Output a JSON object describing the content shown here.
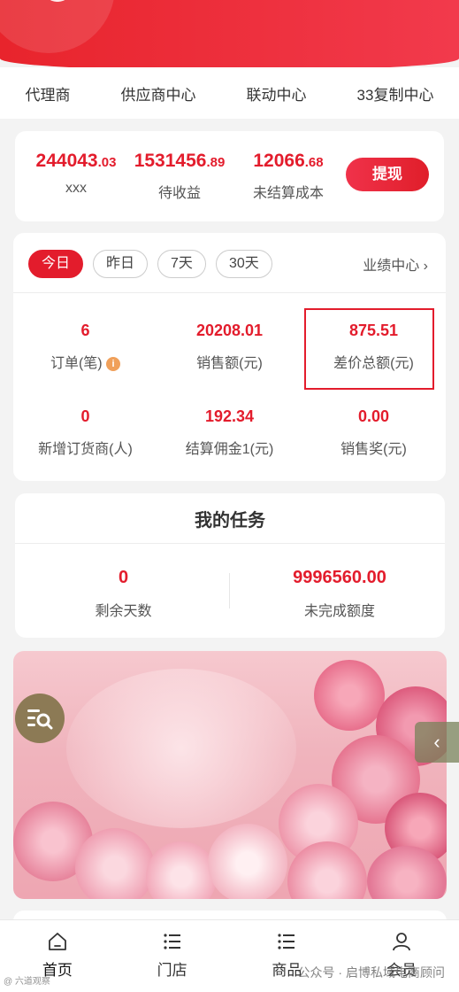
{
  "nav": {
    "items": [
      "代理商",
      "供应商中心",
      "联动中心",
      "33复制中心"
    ]
  },
  "earnings": {
    "items": [
      {
        "int": "244043",
        "dec": ".03",
        "label": "xxx"
      },
      {
        "int": "1531456",
        "dec": ".89",
        "label": "待收益"
      },
      {
        "int": "12066",
        "dec": ".68",
        "label": "未结算成本"
      }
    ],
    "withdraw_label": "提现"
  },
  "stats": {
    "tabs": [
      "今日",
      "昨日",
      "7天",
      "30天"
    ],
    "active_tab": "今日",
    "perf_link": "业绩中心 ›",
    "cells": [
      {
        "value": "6",
        "label": "订单(笔)"
      },
      {
        "value": "20208.01",
        "label": "销售额(元)"
      },
      {
        "value": "875.51",
        "label": "差价总额(元)"
      },
      {
        "value": "0",
        "label": "新增订货商(人)"
      },
      {
        "value": "192.34",
        "label": "结算佣金1(元)"
      },
      {
        "value": "0.00",
        "label": "销售奖(元)"
      }
    ],
    "info_icon_text": "i"
  },
  "task": {
    "title": "我的任务",
    "items": [
      {
        "value": "0",
        "label": "剩余天数"
      },
      {
        "value": "9996560.00",
        "label": "未完成额度"
      }
    ]
  },
  "side_arrow": "‹",
  "bottom_nav": [
    {
      "label": "首页",
      "icon": "home-icon"
    },
    {
      "label": "门店",
      "icon": "list-icon"
    },
    {
      "label": "商品",
      "icon": "list-icon"
    },
    {
      "label": "会员",
      "icon": "user-icon"
    }
  ],
  "watermark": "公众号 · 启博私域电商顾问",
  "watermark_left": "@ 六道观察"
}
